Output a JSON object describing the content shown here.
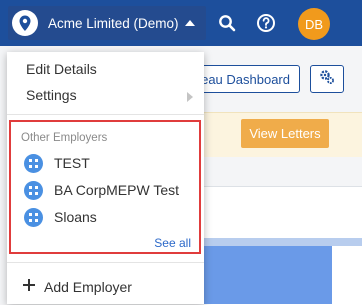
{
  "header": {
    "company_name": "Acme Limited (Demo)",
    "user_initials": "DB",
    "brand_color": "#1d4f9c",
    "avatar_color": "#f19a1c",
    "icons": [
      "logo-pin-icon",
      "caret-up-icon",
      "search-icon",
      "help-icon"
    ]
  },
  "background": {
    "dashboard_button_label": "eau Dashboard",
    "view_letters_label": "View Letters",
    "settings_icon": "sliders-gear-icon"
  },
  "menu": {
    "items": [
      {
        "label": "Edit Details"
      },
      {
        "label": "Settings",
        "icon": "chevron-right-icon"
      }
    ],
    "employers": {
      "heading": "Other Employers",
      "highlight_color": "#e03c3c",
      "list": [
        {
          "label": "TEST",
          "icon": "building-icon"
        },
        {
          "label": "BA CorpMEPW Test",
          "icon": "building-icon"
        },
        {
          "label": "Sloans",
          "icon": "building-icon"
        }
      ],
      "see_all_label": "See all"
    },
    "add_employer_label": "Add Employer",
    "add_icon": "plus-icon"
  }
}
